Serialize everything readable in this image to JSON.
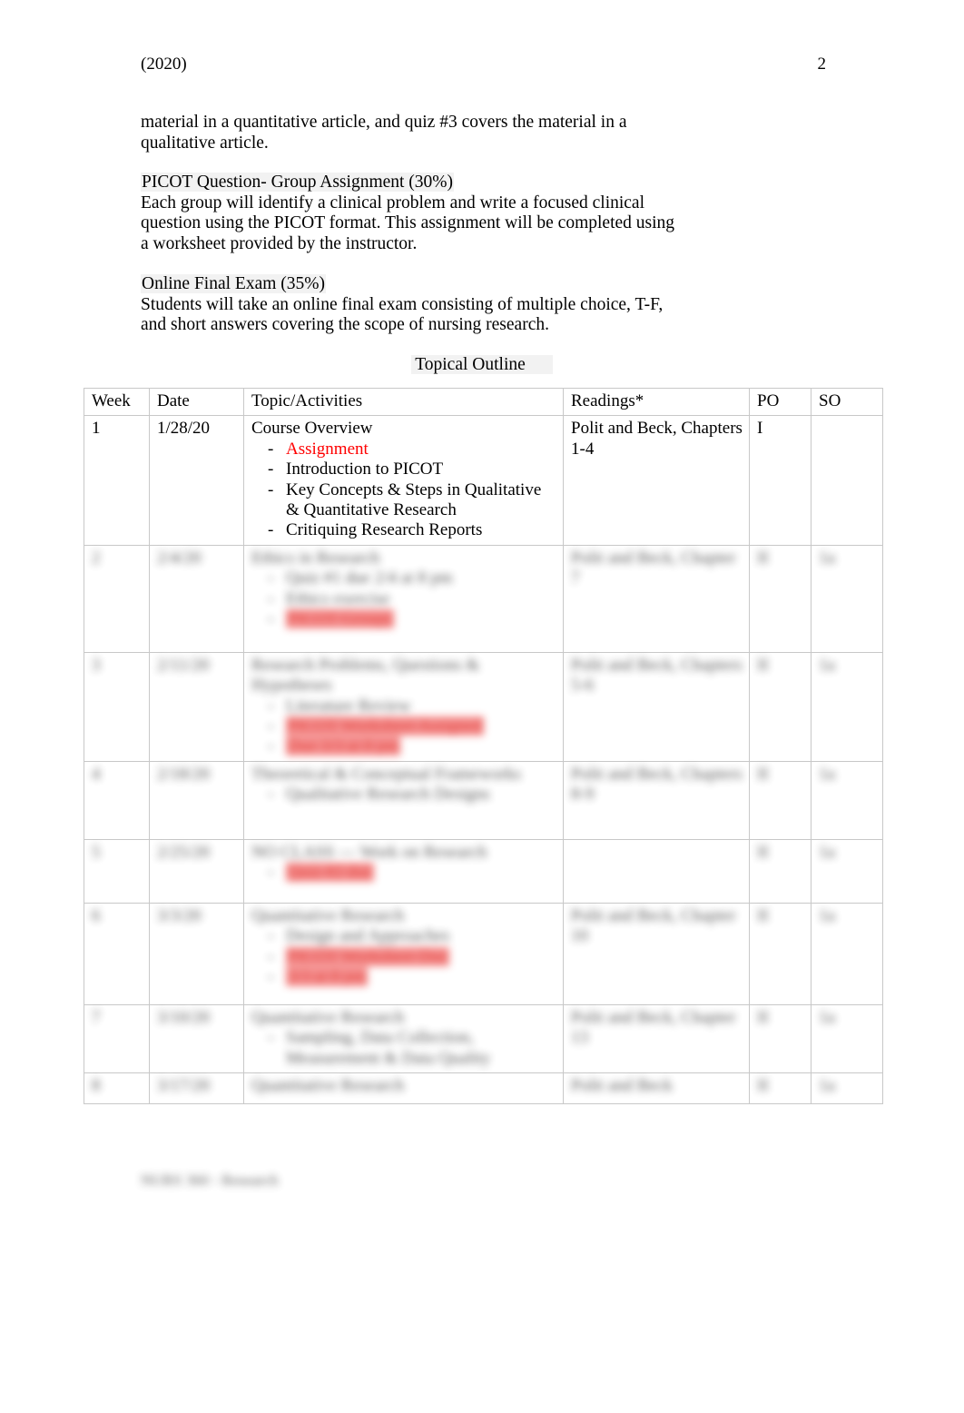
{
  "header": {
    "left": "(2020)",
    "page_number": "2"
  },
  "body": {
    "continued_paragraph": "material in a quantitative article, and quiz #3 covers the material in a qualitative article.",
    "picot": {
      "heading": "PICOT Question- Group Assignment (30%)",
      "text": "Each group will identify a clinical problem and write a focused clinical question using the PICOT format. This assignment will be completed using a worksheet provided by the instructor."
    },
    "final_exam": {
      "heading": "Online Final Exam (35%)",
      "text": "Students will take an online final exam consisting of multiple choice, T-F, and short answers covering the scope of nursing research."
    }
  },
  "table": {
    "caption": "Topical Outline",
    "columns": [
      "Week",
      "Date",
      "Topic/Activities",
      "Readings*",
      "PO",
      "SO"
    ],
    "rows": [
      {
        "week": "1",
        "date": "1/28/20",
        "topic_title": "Course Overview",
        "topic_items": [
          {
            "text": "Assignment",
            "color": "#ff0000"
          },
          {
            "text": "Introduction to PICOT",
            "color": ""
          },
          {
            "text": "Key Concepts & Steps in Qualitative & Quantitative Research",
            "color": ""
          },
          {
            "text": "Critiquing Research Reports",
            "color": ""
          }
        ],
        "readings": "Polit and Beck, Chapters 1-4",
        "po": "I",
        "so": "",
        "redacted": false
      },
      {
        "week": "2",
        "date": "2/4/20",
        "topic_title": "Ethics in Research",
        "topic_items": [
          {
            "text": "Quiz #1 due 2/4 at 8 pm",
            "color": ""
          },
          {
            "text": "Ethics exercise",
            "color": ""
          },
          {
            "text": "",
            "color": ""
          },
          {
            "text": "PICOT Groups",
            "color": "#e03b36"
          }
        ],
        "readings": "Polit and Beck, Chapter 7",
        "po": "II",
        "so": "1a",
        "redacted": true
      },
      {
        "week": "3",
        "date": "2/11/20",
        "topic_title": "Research Problems, Questions & Hypotheses",
        "topic_items": [
          {
            "text": "Literature Review",
            "color": ""
          },
          {
            "text": "PICOT Worksheet Assigned",
            "color": "#e03b36"
          },
          {
            "text": "Due 3/3 at 8 pm",
            "color": "#e03b36"
          }
        ],
        "readings": "Polit and Beck, Chapters 5-6",
        "po": "II",
        "so": "1a",
        "redacted": true
      },
      {
        "week": "4",
        "date": "2/18/20",
        "topic_title": "Theoretical & Conceptual Frameworks",
        "topic_items": [
          {
            "text": "Qualitative Research Designs",
            "color": ""
          }
        ],
        "readings": "Polit and Beck, Chapters 8-9",
        "po": "II",
        "so": "1a",
        "redacted": true
      },
      {
        "week": "5",
        "date": "2/25/20",
        "topic_title": "NO CLASS — Work on Research",
        "topic_items": [
          {
            "text": "Quiz #2 due",
            "color": "#e03b36"
          }
        ],
        "readings": "",
        "po": "II",
        "so": "1a",
        "redacted": true
      },
      {
        "week": "6",
        "date": "3/3/20",
        "topic_title": "Quantitative Research",
        "topic_items": [
          {
            "text": "Design and Approaches",
            "color": ""
          },
          {
            "text": "PICOT Worksheet Due",
            "color": "#e03b36"
          },
          {
            "text": "3/3 at 8 pm",
            "color": "#e03b36"
          }
        ],
        "readings": "Polit and Beck, Chapter 10",
        "po": "II",
        "so": "1a",
        "redacted": true
      },
      {
        "week": "7",
        "date": "3/10/20",
        "topic_title": "Quantitative Research",
        "topic_items": [
          {
            "text": "Sampling, Data Collection, Measurement & Data Quality",
            "color": ""
          }
        ],
        "readings": "Polit and Beck, Chapter 13",
        "po": "II",
        "so": "1a",
        "redacted": true
      },
      {
        "week": "8",
        "date": "3/17/20",
        "topic_title": "Quantitative Research",
        "topic_items": [],
        "readings": "Polit and Beck",
        "po": "II",
        "so": "1a",
        "redacted": true
      }
    ]
  },
  "footer": {
    "text": "NURS 360 - Research"
  }
}
